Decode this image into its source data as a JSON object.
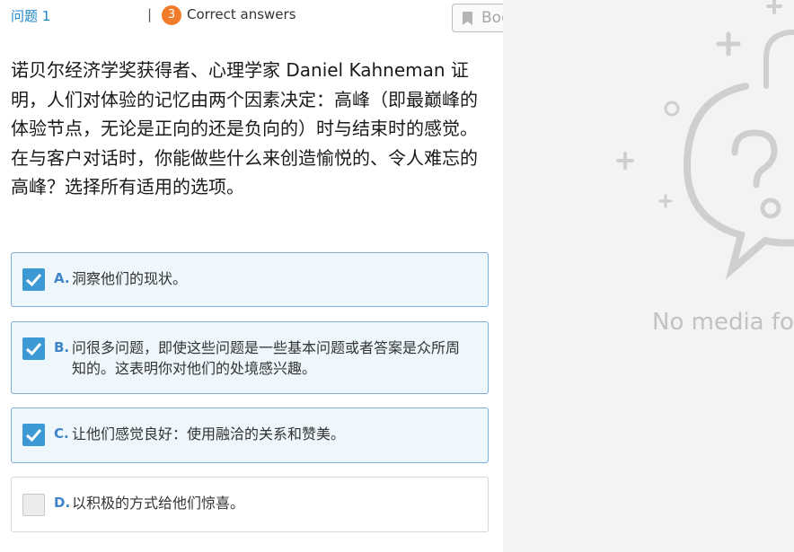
{
  "header": {
    "question_label": "问题 1",
    "separator": "|",
    "correct_count": "3",
    "correct_label": "Correct answers",
    "bookmark_label": "Bookmark"
  },
  "question": {
    "line1": "诺贝尔经济学奖获得者、心理学家 Daniel Kahneman 证明，人们对体验的记忆由两个因素决定：高峰（即最巅峰的体验节点，无论是正向的还是负向的）时与结束时的感觉。",
    "line2": "在与客户对话时，你能做些什么来创造愉悦的、令人难忘的高峰？选择所有适用的选项。"
  },
  "options": [
    {
      "letter": "A.",
      "text": "洞察他们的现状。",
      "checked": true
    },
    {
      "letter": "B.",
      "text": "问很多问题，即使这些问题是一些基本问题或者答案是众所周知的。这表明你对他们的处境感兴趣。",
      "checked": true
    },
    {
      "letter": "C.",
      "text": "让他们感觉良好：使用融洽的关系和赞美。",
      "checked": true
    },
    {
      "letter": "D.",
      "text": "以积极的方式给他们惊喜。",
      "checked": false
    }
  ],
  "media": {
    "placeholder_text": "No media fo",
    "icon": "question-bubble-icon"
  },
  "colors": {
    "accent": "#3d99d4",
    "badge": "#f07b2a",
    "selected_bg": "#eef7fc"
  }
}
